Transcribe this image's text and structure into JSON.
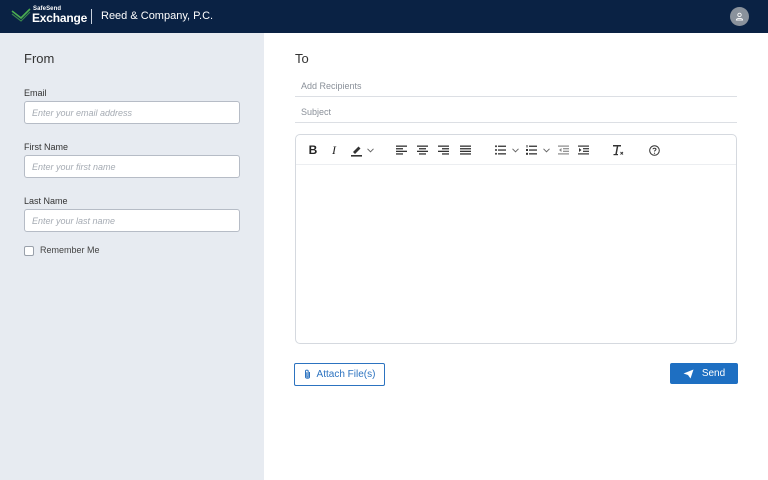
{
  "header": {
    "brand_small": "SafeSend",
    "brand_big": "Exchange",
    "company_name": "Reed & Company, P.C.",
    "avatar_icon": "user-icon"
  },
  "from_panel": {
    "title": "From",
    "email": {
      "label": "Email",
      "placeholder": "Enter your email address",
      "value": ""
    },
    "first_name": {
      "label": "First Name",
      "placeholder": "Enter your first name",
      "value": ""
    },
    "last_name": {
      "label": "Last Name",
      "placeholder": "Enter your last name",
      "value": ""
    },
    "remember_me": {
      "label": "Remember Me",
      "checked": false
    }
  },
  "to_panel": {
    "title": "To",
    "recipients_placeholder": "Add Recipients",
    "subject_placeholder": "Subject"
  },
  "editor": {
    "toolbar": [
      "bold",
      "italic",
      "highlight-color",
      "dropdown-chevron",
      "align-left",
      "align-center",
      "align-right",
      "justify",
      "bullet-list",
      "bullet-list-options",
      "numbered-list",
      "numbered-list-options",
      "outdent",
      "indent",
      "clear-formatting",
      "help"
    ],
    "toolbar_text": {
      "bold": "B",
      "italic": "I"
    }
  },
  "actions": {
    "attach_label": "Attach File(s)",
    "attach_icon": "paperclip-icon",
    "send_label": "Send",
    "send_icon": "paper-plane-icon"
  },
  "colors": {
    "header_bg": "#0a2244",
    "left_panel_bg": "#e7ebf1",
    "accent": "#1e6fc2",
    "brand_green": "#4caf50"
  }
}
